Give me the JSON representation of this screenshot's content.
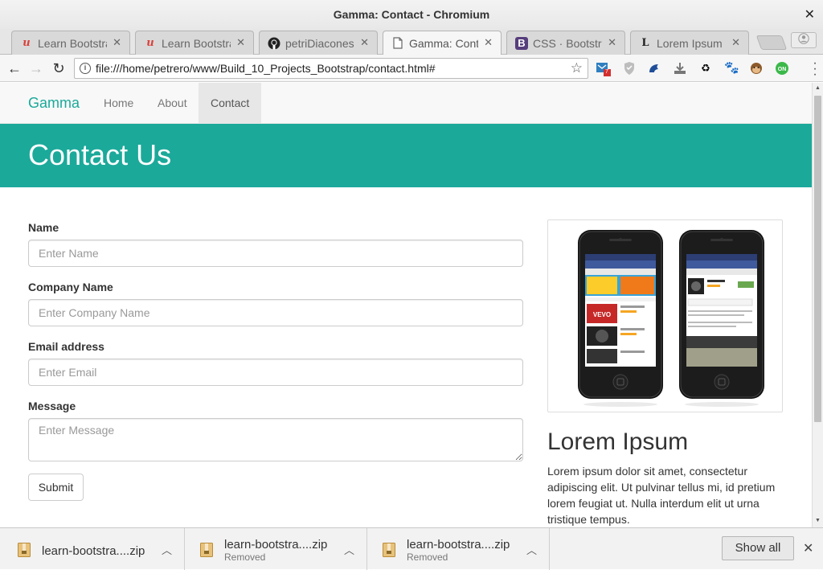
{
  "window": {
    "title": "Gamma: Contact - Chromium"
  },
  "tabs": [
    {
      "label": "Learn Bootstrap",
      "icon": "udemy-icon"
    },
    {
      "label": "Learn Bootstrap",
      "icon": "udemy-icon"
    },
    {
      "label": "petriDiaconescu",
      "icon": "github-icon"
    },
    {
      "label": "Gamma: Contact",
      "icon": "document-icon",
      "active": true
    },
    {
      "label": "CSS · Bootstrap",
      "icon": "bootstrap-icon"
    },
    {
      "label": "Lorem Ipsum",
      "icon": "lipsum-icon"
    }
  ],
  "toolbar": {
    "url": "file:///home/petrero/www/Build_10_Projects_Bootstrap/contact.html#",
    "extension_badge": "7"
  },
  "site": {
    "brand": "Gamma",
    "nav": [
      "Home",
      "About",
      "Contact"
    ],
    "hero_title": "Contact Us",
    "form": {
      "name_label": "Name",
      "name_placeholder": "Enter Name",
      "company_label": "Company Name",
      "company_placeholder": "Enter Company Name",
      "email_label": "Email address",
      "email_placeholder": "Enter Email",
      "message_label": "Message",
      "message_placeholder": "Enter Message",
      "submit": "Submit"
    },
    "sidebar": {
      "title": "Lorem Ipsum",
      "text": "Lorem ipsum dolor sit amet, consectetur adipiscing elit. Ut pulvinar tellus mi, id pretium lorem feugiat ut. Nulla interdum elit ut urna tristique tempus."
    }
  },
  "downloads": [
    {
      "name": "learn-bootstra....zip",
      "status": ""
    },
    {
      "name": "learn-bootstra....zip",
      "status": "Removed"
    },
    {
      "name": "learn-bootstra....zip",
      "status": "Removed"
    }
  ],
  "shelf": {
    "show_all": "Show all"
  },
  "colors": {
    "accent": "#1ba99a",
    "bootstrap_purple": "#563d7c",
    "udemy_red": "#d9413c"
  }
}
